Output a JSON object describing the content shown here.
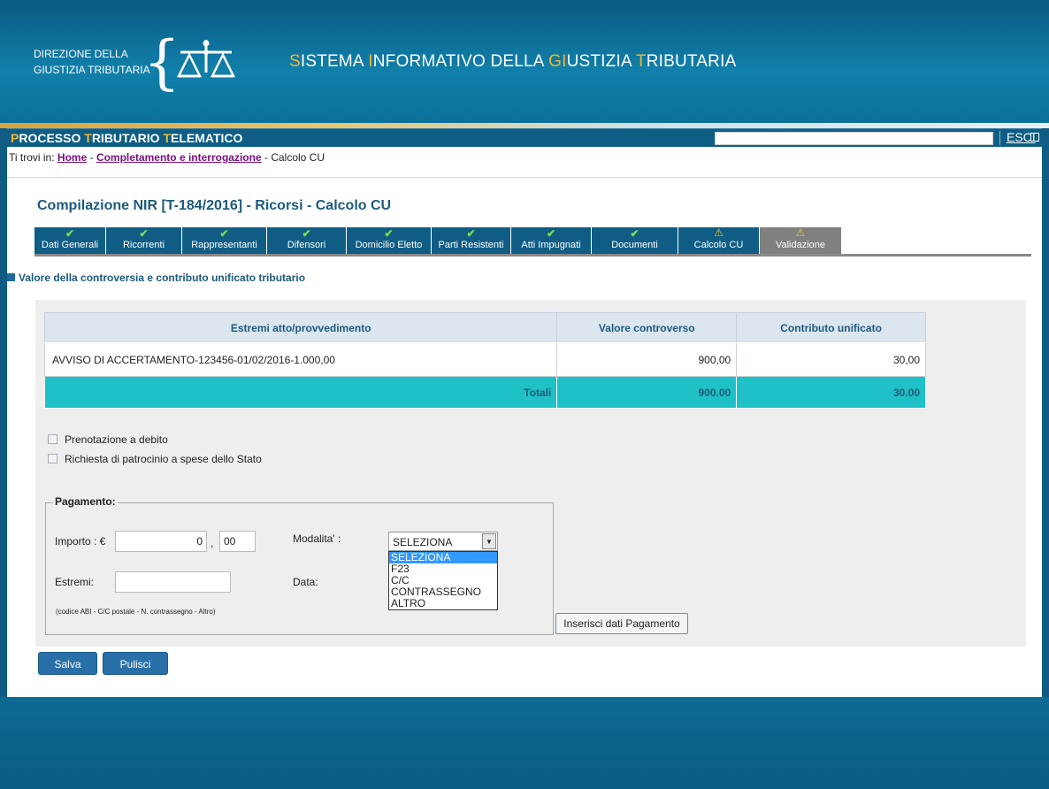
{
  "header": {
    "org_line1": "DIREZIONE DELLA",
    "org_line2": "GIUSTIZIA TRIBUTARIA",
    "system_title": {
      "p1_acc": "S",
      "p1": "ISTEMA ",
      "p2_acc": "I",
      "p2": "NFORMATIVO DELLA ",
      "p3_acc": "GI",
      "p3": "USTIZIA ",
      "p4_acc": "T",
      "p4": "RIBUTARIA"
    }
  },
  "topbar": {
    "title": {
      "p1_acc": "P",
      "p1": "ROCESSO ",
      "p2_acc": "T",
      "p2": "RIBUTARIO ",
      "p3_acc": "T",
      "p3": "ELEMATICO"
    },
    "logout_label": "ESCI"
  },
  "breadcrumb": {
    "prefix": "Ti trovi in:",
    "home": "Home",
    "sep": "-",
    "section": "Completamento e interrogazione",
    "current": "Calcolo CU"
  },
  "page_title": "Compilazione NIR [T-184/2016] - Ricorsi - Calcolo CU",
  "tabs": [
    {
      "label": "Dati Generali",
      "status": "ok"
    },
    {
      "label": "Ricorrenti",
      "status": "ok"
    },
    {
      "label": "Rappresentanti",
      "status": "ok"
    },
    {
      "label": "Difensori",
      "status": "ok"
    },
    {
      "label": "Domicilio Eletto",
      "status": "ok"
    },
    {
      "label": "Parti Resistenti",
      "status": "ok"
    },
    {
      "label": "Atti Impugnati",
      "status": "ok"
    },
    {
      "label": "Documenti",
      "status": "ok"
    },
    {
      "label": "Calcolo CU",
      "status": "warning"
    },
    {
      "label": "Validazione",
      "status": "warning"
    }
  ],
  "section_title": "Valore della controversia e contributo unificato tributario",
  "table": {
    "headers": [
      "Estremi atto/provvedimento",
      "Valore controverso",
      "Contributo unificato"
    ],
    "rows": [
      {
        "estremi": "AVVISO DI ACCERTAMENTO-123456-01/02/2016-1.000,00",
        "valore": "900,00",
        "contributo": "30,00"
      }
    ],
    "totals": {
      "label": "Totali",
      "valore": "900.00",
      "contributo": "30.00"
    }
  },
  "checkboxes": [
    {
      "label": "Prenotazione a debito",
      "checked": false
    },
    {
      "label": "Richiesta di patrocinio a spese dello Stato",
      "checked": false
    }
  ],
  "payment": {
    "legend": "Pagamento:",
    "importo_label": "Importo : €",
    "importo_int": "0",
    "comma": ",",
    "importo_dec": "00",
    "estremi_label": "Estremi:",
    "estremi_value": "",
    "note": "(codice ABI - C/C postale - N. contrassegno - Altro)",
    "modalita_label": "Modalita' :",
    "modalita_selected": "SELEZIONA",
    "modalita_options": [
      "SELEZIONA",
      "F23",
      "C/C",
      "CONTRASSEGNO",
      "ALTRO"
    ],
    "data_label": "Data:",
    "insert_button": "Inserisci dati Pagamento"
  },
  "actions": {
    "save": "Salva",
    "clear": "Pulisci"
  },
  "colors": {
    "primary": "#0f5d84",
    "accent": "#f0b632",
    "totals_bg": "#1fc1c9",
    "ok": "#7be04a",
    "warning": "#f3c12f"
  }
}
